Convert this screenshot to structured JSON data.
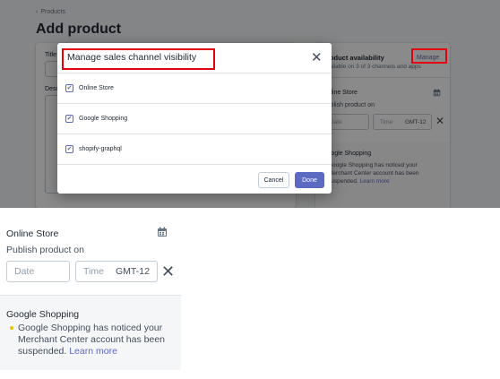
{
  "page": {
    "breadcrumb": "Products",
    "title": "Add product",
    "title_field_label": "Title",
    "description_field_label": "Description"
  },
  "side_card": {
    "title": "Product availability",
    "subtitle": "Available on 3 of 3 channels and apps",
    "manage_label": "Manage",
    "online_store": {
      "name": "Online Store",
      "publish_label": "Publish product on",
      "date_placeholder": "Date",
      "time_placeholder": "Time",
      "timezone": "GMT-12"
    },
    "google_shopping": {
      "name": "Google Shopping",
      "message": "Google Shopping has noticed your Merchant Center account has been suspended.",
      "learn_more": "Learn more"
    }
  },
  "modal": {
    "title": "Manage sales channel visibility",
    "channels": [
      {
        "label": "Online Store",
        "checked": true
      },
      {
        "label": "Google Shopping",
        "checked": true
      },
      {
        "label": "shopify-graphql",
        "checked": true
      }
    ],
    "cancel_label": "Cancel",
    "done_label": "Done"
  },
  "zoom": {
    "online_store_title": "Online Store",
    "publish_label": "Publish product on",
    "date_placeholder": "Date",
    "time_placeholder": "Time",
    "timezone": "GMT-12",
    "google_shopping_title": "Google Shopping",
    "message": "Google Shopping has noticed your Merchant Center account has been suspended.",
    "learn_more": "Learn more"
  },
  "colors": {
    "accent": "#5c6ac4",
    "highlight": "#e3000f",
    "warning_bullet": "#eec200"
  }
}
